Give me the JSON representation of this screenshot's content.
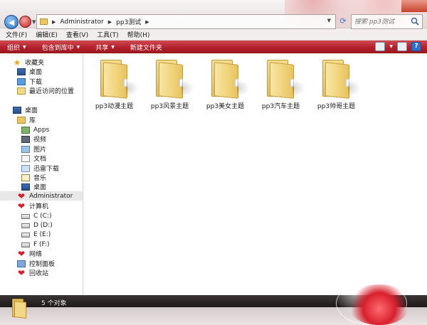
{
  "address": {
    "crumbs": [
      "Administrator",
      "pp3测试"
    ]
  },
  "search": {
    "placeholder": "搜索 pp3测试"
  },
  "menu": [
    "文件(F)",
    "编辑(E)",
    "查看(V)",
    "工具(T)",
    "帮助(H)"
  ],
  "toolbar": {
    "organize": "组织",
    "include_library": "包含到库中",
    "share": "共享",
    "new_folder": "新建文件夹"
  },
  "sidebar": {
    "favorites": "收藏夹",
    "desktop_fav": "桌面",
    "downloads": "下载",
    "recent": "最近访问的位置",
    "desktop_root": "桌面",
    "library": "库",
    "apps": "Apps",
    "videos": "视频",
    "pictures": "图片",
    "documents": "文档",
    "thunder": "迅雷下载",
    "music": "音乐",
    "desktop_lib": "桌面",
    "administrator": "Administrator",
    "computer": "计算机",
    "drive_c": "C (C:)",
    "drive_d": "D (D:)",
    "drive_e": "E (E:)",
    "drive_f": "F (F:)",
    "network": "网络",
    "control_panel": "控制面板",
    "recycle_bin": "回收站"
  },
  "folders": [
    "pp3动漫主题",
    "pp3风景主题",
    "pp3美女主题",
    "pp3汽车主题",
    "pp3帅哥主题"
  ],
  "status": {
    "count": "5 个对象"
  },
  "colors": {
    "toolbar_red": "#b2202b",
    "heart_red": "#d21f2b"
  }
}
